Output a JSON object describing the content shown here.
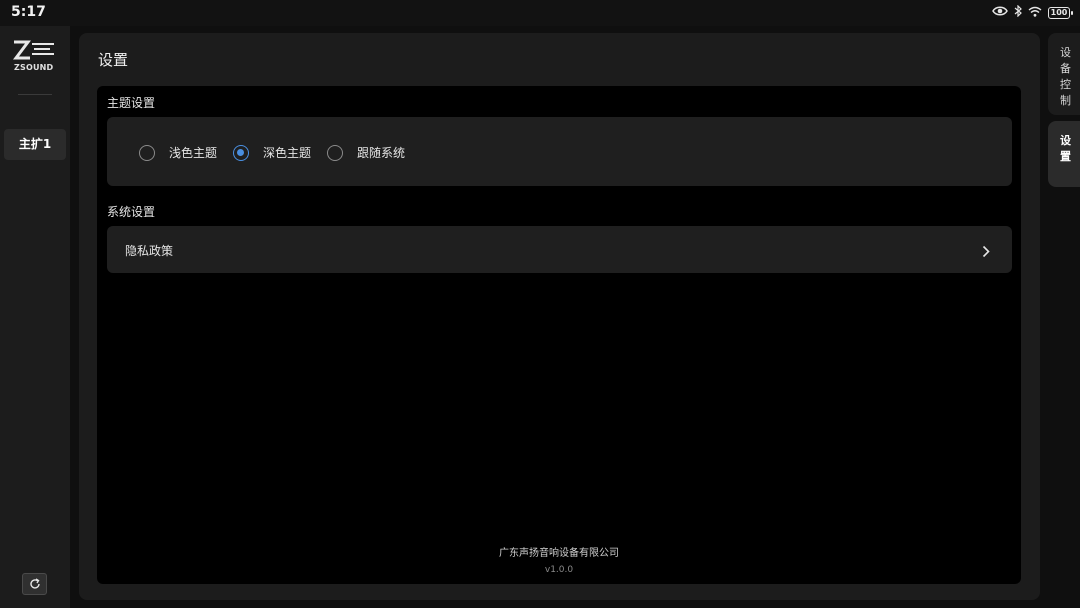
{
  "status_bar": {
    "time": "5:17",
    "battery": "100",
    "icons": [
      "eye-icon",
      "bluetooth-icon",
      "wifi-icon",
      "battery-icon"
    ]
  },
  "sidebar": {
    "logo_text": "ZSOUND",
    "items": [
      {
        "label": "主扩1"
      }
    ],
    "refresh_icon": "refresh-icon"
  },
  "page": {
    "title": "设置"
  },
  "theme_section": {
    "label": "主题设置",
    "options": [
      {
        "label": "浅色主题",
        "checked": false
      },
      {
        "label": "深色主题",
        "checked": true
      },
      {
        "label": "跟随系统",
        "checked": false
      }
    ]
  },
  "system_section": {
    "label": "系统设置",
    "privacy_label": "隐私政策"
  },
  "footer": {
    "company": "广东声扬音响设备有限公司",
    "version": "v1.0.0"
  },
  "right_tabs": [
    {
      "label": "设备控制",
      "active": false
    },
    {
      "label": "设置",
      "active": true
    }
  ],
  "colors": {
    "accent": "#4a8fe0",
    "background": "#000000",
    "panel": "#1c1c1c",
    "card": "#1f1f1f"
  }
}
